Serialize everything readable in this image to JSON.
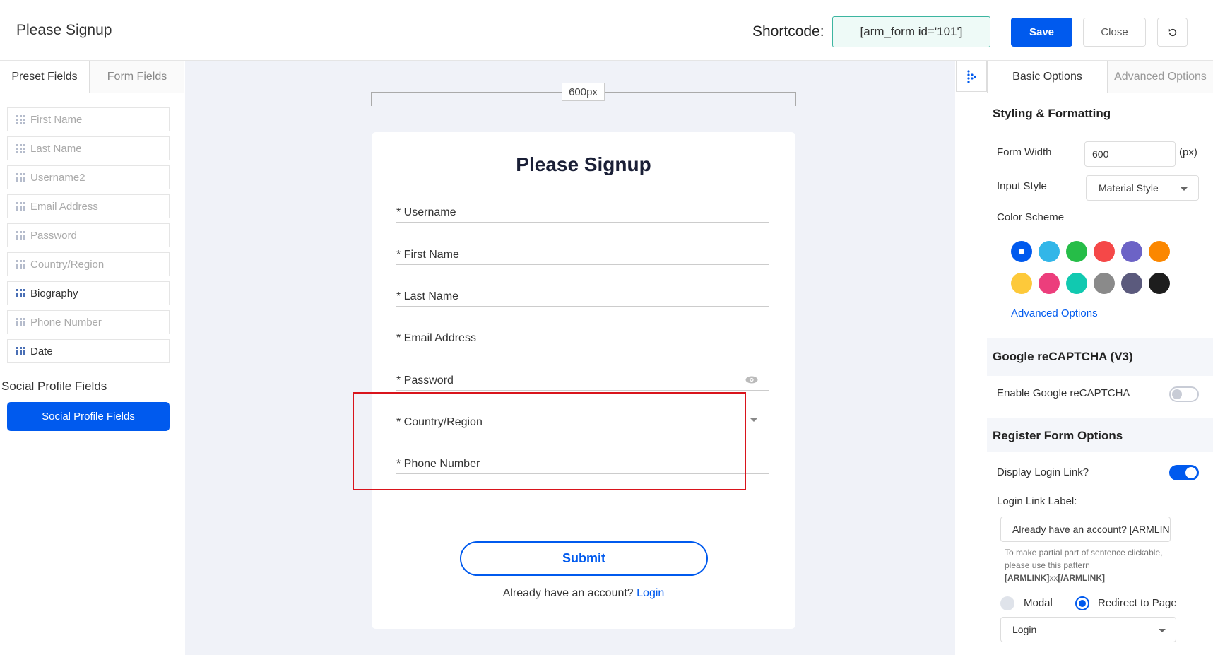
{
  "header": {
    "title": "Please Signup",
    "shortcode_label": "Shortcode:",
    "shortcode_value": "[arm_form id='101']",
    "save_label": "Save",
    "close_label": "Close",
    "reset_icon": "reset-icon"
  },
  "left_panel": {
    "tabs": [
      {
        "label": "Preset Fields"
      },
      {
        "label": "Form Fields"
      }
    ],
    "fields": [
      {
        "label": "First Name"
      },
      {
        "label": "Last Name"
      },
      {
        "label": "Username2"
      },
      {
        "label": "Email Address"
      },
      {
        "label": "Password"
      },
      {
        "label": "Country/Region"
      },
      {
        "label": "Biography"
      },
      {
        "label": "Phone Number"
      },
      {
        "label": "Date"
      }
    ],
    "social_title": "Social Profile Fields",
    "social_button": "Social Profile Fields"
  },
  "canvas": {
    "width_badge": "600px",
    "form": {
      "heading": "Please Signup",
      "fields": [
        {
          "label": "* Username"
        },
        {
          "label": "* First Name"
        },
        {
          "label": "* Last Name"
        },
        {
          "label": "* Email Address"
        },
        {
          "label": "* Password"
        },
        {
          "label": "* Country/Region"
        },
        {
          "label": "* Phone Number"
        }
      ],
      "submit_label": "Submit",
      "login_text": "Already have an account?",
      "login_link": "Login"
    }
  },
  "right_panel": {
    "tabs": [
      {
        "label": "Basic Options"
      },
      {
        "label": "Advanced Options"
      }
    ],
    "styling": {
      "title": "Styling & Formatting",
      "form_width_label": "Form Width",
      "form_width_value": "600",
      "form_width_unit": "(px)",
      "input_style_label": "Input Style",
      "input_style_value": "Material Style",
      "color_scheme_label": "Color Scheme",
      "colors": [
        "#005aee",
        "#32b6e8",
        "#26bd48",
        "#f54848",
        "#6c63c6",
        "#fb8700",
        "#fdc93a",
        "#ec3e7c",
        "#11c9b0",
        "#8a8a8a",
        "#5b5a7d",
        "#1d1d1d"
      ],
      "selected_color": "#005aee",
      "advanced_link": "Advanced Options"
    },
    "recaptcha": {
      "title": "Google reCAPTCHA (V3)",
      "enable_label": "Enable Google reCAPTCHA",
      "enabled": false
    },
    "register": {
      "title": "Register Form Options",
      "display_login_label": "Display Login Link?",
      "display_login_enabled": true,
      "login_link_label_title": "Login Link Label:",
      "login_link_label_value": "Already have an account? [ARMLINK]Login[/ARMLINK]",
      "hint_line1": "To make partial part of sentence clickable,",
      "hint_line2": "please use this pattern",
      "hint_pattern_open": "[ARMLINK]",
      "hint_pattern_mid": "xx",
      "hint_pattern_close": "[/ARMLINK]",
      "radio_modal": "Modal",
      "radio_redirect": "Redirect to Page",
      "selected_radio": "Redirect to Page",
      "page_select_value": "Login"
    }
  }
}
